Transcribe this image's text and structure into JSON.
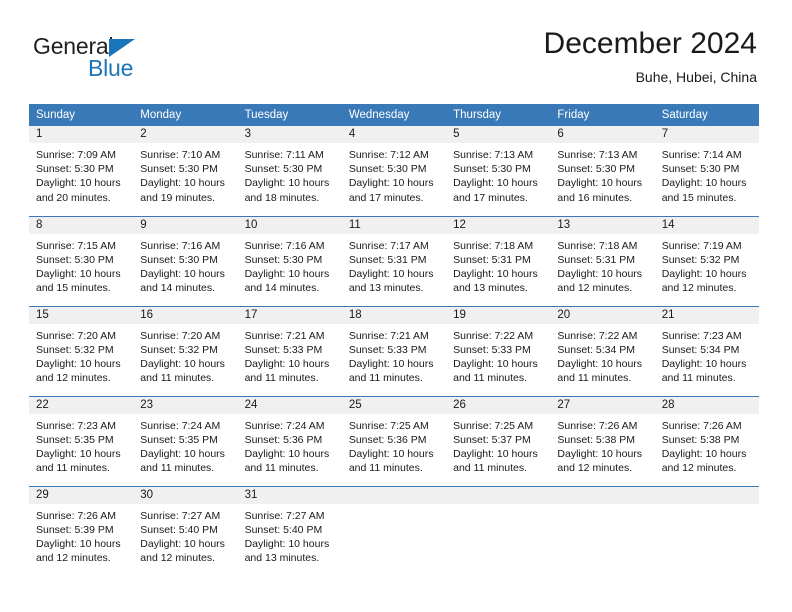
{
  "brand": {
    "name_part1": "General",
    "name_part2": "Blue",
    "logo_icon": "triangle-logo-icon"
  },
  "header": {
    "title": "December 2024",
    "subtitle": "Buhe, Hubei, China"
  },
  "colors": {
    "header_blue": "#3a79b8",
    "brand_blue": "#1b75bb",
    "daynum_band": "#f0f0f0",
    "text": "#1a1a1a"
  },
  "weekdays": [
    "Sunday",
    "Monday",
    "Tuesday",
    "Wednesday",
    "Thursday",
    "Friday",
    "Saturday"
  ],
  "labels": {
    "sunrise_prefix": "Sunrise:",
    "sunset_prefix": "Sunset:",
    "daylight_prefix": "Daylight:"
  },
  "weeks": [
    [
      {
        "day": "1",
        "sunrise": "Sunrise: 7:09 AM",
        "sunset": "Sunset: 5:30 PM",
        "daylight1": "Daylight: 10 hours",
        "daylight2": "and 20 minutes."
      },
      {
        "day": "2",
        "sunrise": "Sunrise: 7:10 AM",
        "sunset": "Sunset: 5:30 PM",
        "daylight1": "Daylight: 10 hours",
        "daylight2": "and 19 minutes."
      },
      {
        "day": "3",
        "sunrise": "Sunrise: 7:11 AM",
        "sunset": "Sunset: 5:30 PM",
        "daylight1": "Daylight: 10 hours",
        "daylight2": "and 18 minutes."
      },
      {
        "day": "4",
        "sunrise": "Sunrise: 7:12 AM",
        "sunset": "Sunset: 5:30 PM",
        "daylight1": "Daylight: 10 hours",
        "daylight2": "and 17 minutes."
      },
      {
        "day": "5",
        "sunrise": "Sunrise: 7:13 AM",
        "sunset": "Sunset: 5:30 PM",
        "daylight1": "Daylight: 10 hours",
        "daylight2": "and 17 minutes."
      },
      {
        "day": "6",
        "sunrise": "Sunrise: 7:13 AM",
        "sunset": "Sunset: 5:30 PM",
        "daylight1": "Daylight: 10 hours",
        "daylight2": "and 16 minutes."
      },
      {
        "day": "7",
        "sunrise": "Sunrise: 7:14 AM",
        "sunset": "Sunset: 5:30 PM",
        "daylight1": "Daylight: 10 hours",
        "daylight2": "and 15 minutes."
      }
    ],
    [
      {
        "day": "8",
        "sunrise": "Sunrise: 7:15 AM",
        "sunset": "Sunset: 5:30 PM",
        "daylight1": "Daylight: 10 hours",
        "daylight2": "and 15 minutes."
      },
      {
        "day": "9",
        "sunrise": "Sunrise: 7:16 AM",
        "sunset": "Sunset: 5:30 PM",
        "daylight1": "Daylight: 10 hours",
        "daylight2": "and 14 minutes."
      },
      {
        "day": "10",
        "sunrise": "Sunrise: 7:16 AM",
        "sunset": "Sunset: 5:30 PM",
        "daylight1": "Daylight: 10 hours",
        "daylight2": "and 14 minutes."
      },
      {
        "day": "11",
        "sunrise": "Sunrise: 7:17 AM",
        "sunset": "Sunset: 5:31 PM",
        "daylight1": "Daylight: 10 hours",
        "daylight2": "and 13 minutes."
      },
      {
        "day": "12",
        "sunrise": "Sunrise: 7:18 AM",
        "sunset": "Sunset: 5:31 PM",
        "daylight1": "Daylight: 10 hours",
        "daylight2": "and 13 minutes."
      },
      {
        "day": "13",
        "sunrise": "Sunrise: 7:18 AM",
        "sunset": "Sunset: 5:31 PM",
        "daylight1": "Daylight: 10 hours",
        "daylight2": "and 12 minutes."
      },
      {
        "day": "14",
        "sunrise": "Sunrise: 7:19 AM",
        "sunset": "Sunset: 5:32 PM",
        "daylight1": "Daylight: 10 hours",
        "daylight2": "and 12 minutes."
      }
    ],
    [
      {
        "day": "15",
        "sunrise": "Sunrise: 7:20 AM",
        "sunset": "Sunset: 5:32 PM",
        "daylight1": "Daylight: 10 hours",
        "daylight2": "and 12 minutes."
      },
      {
        "day": "16",
        "sunrise": "Sunrise: 7:20 AM",
        "sunset": "Sunset: 5:32 PM",
        "daylight1": "Daylight: 10 hours",
        "daylight2": "and 11 minutes."
      },
      {
        "day": "17",
        "sunrise": "Sunrise: 7:21 AM",
        "sunset": "Sunset: 5:33 PM",
        "daylight1": "Daylight: 10 hours",
        "daylight2": "and 11 minutes."
      },
      {
        "day": "18",
        "sunrise": "Sunrise: 7:21 AM",
        "sunset": "Sunset: 5:33 PM",
        "daylight1": "Daylight: 10 hours",
        "daylight2": "and 11 minutes."
      },
      {
        "day": "19",
        "sunrise": "Sunrise: 7:22 AM",
        "sunset": "Sunset: 5:33 PM",
        "daylight1": "Daylight: 10 hours",
        "daylight2": "and 11 minutes."
      },
      {
        "day": "20",
        "sunrise": "Sunrise: 7:22 AM",
        "sunset": "Sunset: 5:34 PM",
        "daylight1": "Daylight: 10 hours",
        "daylight2": "and 11 minutes."
      },
      {
        "day": "21",
        "sunrise": "Sunrise: 7:23 AM",
        "sunset": "Sunset: 5:34 PM",
        "daylight1": "Daylight: 10 hours",
        "daylight2": "and 11 minutes."
      }
    ],
    [
      {
        "day": "22",
        "sunrise": "Sunrise: 7:23 AM",
        "sunset": "Sunset: 5:35 PM",
        "daylight1": "Daylight: 10 hours",
        "daylight2": "and 11 minutes."
      },
      {
        "day": "23",
        "sunrise": "Sunrise: 7:24 AM",
        "sunset": "Sunset: 5:35 PM",
        "daylight1": "Daylight: 10 hours",
        "daylight2": "and 11 minutes."
      },
      {
        "day": "24",
        "sunrise": "Sunrise: 7:24 AM",
        "sunset": "Sunset: 5:36 PM",
        "daylight1": "Daylight: 10 hours",
        "daylight2": "and 11 minutes."
      },
      {
        "day": "25",
        "sunrise": "Sunrise: 7:25 AM",
        "sunset": "Sunset: 5:36 PM",
        "daylight1": "Daylight: 10 hours",
        "daylight2": "and 11 minutes."
      },
      {
        "day": "26",
        "sunrise": "Sunrise: 7:25 AM",
        "sunset": "Sunset: 5:37 PM",
        "daylight1": "Daylight: 10 hours",
        "daylight2": "and 11 minutes."
      },
      {
        "day": "27",
        "sunrise": "Sunrise: 7:26 AM",
        "sunset": "Sunset: 5:38 PM",
        "daylight1": "Daylight: 10 hours",
        "daylight2": "and 12 minutes."
      },
      {
        "day": "28",
        "sunrise": "Sunrise: 7:26 AM",
        "sunset": "Sunset: 5:38 PM",
        "daylight1": "Daylight: 10 hours",
        "daylight2": "and 12 minutes."
      }
    ],
    [
      {
        "day": "29",
        "sunrise": "Sunrise: 7:26 AM",
        "sunset": "Sunset: 5:39 PM",
        "daylight1": "Daylight: 10 hours",
        "daylight2": "and 12 minutes."
      },
      {
        "day": "30",
        "sunrise": "Sunrise: 7:27 AM",
        "sunset": "Sunset: 5:40 PM",
        "daylight1": "Daylight: 10 hours",
        "daylight2": "and 12 minutes."
      },
      {
        "day": "31",
        "sunrise": "Sunrise: 7:27 AM",
        "sunset": "Sunset: 5:40 PM",
        "daylight1": "Daylight: 10 hours",
        "daylight2": "and 13 minutes."
      },
      {
        "day": "",
        "sunrise": "",
        "sunset": "",
        "daylight1": "",
        "daylight2": ""
      },
      {
        "day": "",
        "sunrise": "",
        "sunset": "",
        "daylight1": "",
        "daylight2": ""
      },
      {
        "day": "",
        "sunrise": "",
        "sunset": "",
        "daylight1": "",
        "daylight2": ""
      },
      {
        "day": "",
        "sunrise": "",
        "sunset": "",
        "daylight1": "",
        "daylight2": ""
      }
    ]
  ]
}
